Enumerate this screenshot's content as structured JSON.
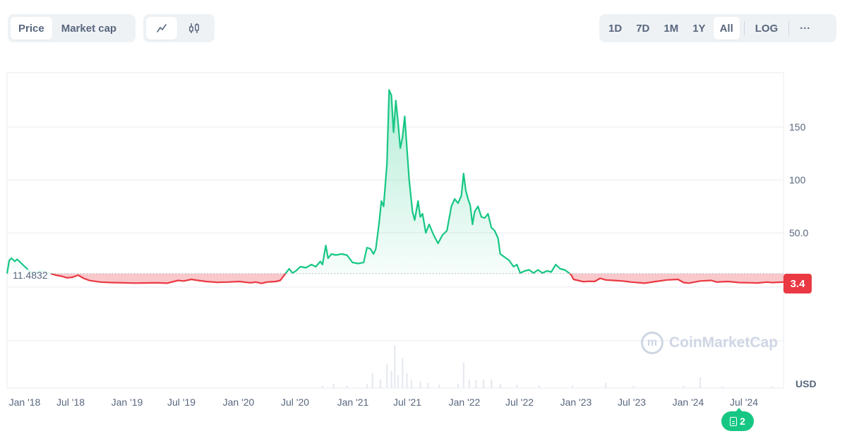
{
  "toolbar": {
    "type_tabs": [
      {
        "label": "Price",
        "active": true
      },
      {
        "label": "Market cap",
        "active": false
      }
    ],
    "view_tabs": [
      {
        "icon": "line-chart-icon",
        "active": true
      },
      {
        "icon": "candlestick-icon",
        "active": false
      }
    ],
    "range_tabs": [
      {
        "label": "1D",
        "active": false
      },
      {
        "label": "7D",
        "active": false
      },
      {
        "label": "1M",
        "active": false
      },
      {
        "label": "1Y",
        "active": false
      },
      {
        "label": "All",
        "active": true
      }
    ],
    "log_label": "LOG",
    "more_label": "···"
  },
  "chart": {
    "baseline_label": "11.4832",
    "current_price_label": "3.4",
    "currency_label": "USD",
    "watermark_text": "CoinMarketCap",
    "news_count": "2",
    "colors": {
      "up": "#16c784",
      "down": "#ea3943",
      "grid": "#f0f2f5",
      "volume": "#e6eaf0"
    }
  },
  "chart_data": {
    "type": "area",
    "title": "",
    "xlabel": "",
    "ylabel": "USD",
    "baseline": 11.4832,
    "current": 3.4,
    "y_ticks": [
      50,
      100,
      150
    ],
    "y_tick_labels": [
      "50.0",
      "100",
      "150"
    ],
    "ylim": [
      0,
      195
    ],
    "x_tick_labels": [
      "Jan '18",
      "Jul '18",
      "Jan '19",
      "Jul '19",
      "Jan '20",
      "Jul '20",
      "Jan '21",
      "Jul '21",
      "Jan '22",
      "Jul '22",
      "Jan '23",
      "Jul '23",
      "Jan '24",
      "Jul '24"
    ],
    "x_range": [
      2017.96,
      2024.95
    ],
    "series": [
      {
        "name": "Price",
        "points": [
          [
            2017.96,
            11.5
          ],
          [
            2017.98,
            24
          ],
          [
            2018.0,
            26
          ],
          [
            2018.03,
            23
          ],
          [
            2018.05,
            25
          ],
          [
            2018.08,
            22
          ],
          [
            2018.1,
            20
          ],
          [
            2018.13,
            17
          ],
          [
            2018.17,
            13
          ],
          [
            2018.21,
            12
          ],
          [
            2018.26,
            14
          ],
          [
            2018.31,
            13
          ],
          [
            2018.35,
            11.5
          ],
          [
            2018.4,
            10
          ],
          [
            2018.45,
            9
          ],
          [
            2018.5,
            7.5
          ],
          [
            2018.55,
            8
          ],
          [
            2018.6,
            10
          ],
          [
            2018.65,
            7
          ],
          [
            2018.7,
            5
          ],
          [
            2018.8,
            3.5
          ],
          [
            2018.9,
            3
          ],
          [
            2019.0,
            2.8
          ],
          [
            2019.1,
            2.5
          ],
          [
            2019.2,
            2.6
          ],
          [
            2019.3,
            2.8
          ],
          [
            2019.4,
            2.4
          ],
          [
            2019.5,
            5
          ],
          [
            2019.55,
            4.5
          ],
          [
            2019.62,
            6
          ],
          [
            2019.68,
            5
          ],
          [
            2019.75,
            4
          ],
          [
            2019.85,
            3.2
          ],
          [
            2019.95,
            3.5
          ],
          [
            2020.05,
            4
          ],
          [
            2020.15,
            2.8
          ],
          [
            2020.2,
            3.5
          ],
          [
            2020.25,
            2.2
          ],
          [
            2020.3,
            3.5
          ],
          [
            2020.38,
            4
          ],
          [
            2020.42,
            5
          ],
          [
            2020.47,
            12
          ],
          [
            2020.5,
            16
          ],
          [
            2020.53,
            12
          ],
          [
            2020.56,
            14
          ],
          [
            2020.6,
            18
          ],
          [
            2020.65,
            17
          ],
          [
            2020.7,
            20
          ],
          [
            2020.74,
            18
          ],
          [
            2020.78,
            23
          ],
          [
            2020.8,
            20
          ],
          [
            2020.83,
            38
          ],
          [
            2020.85,
            26
          ],
          [
            2020.88,
            30
          ],
          [
            2020.92,
            29
          ],
          [
            2020.97,
            30
          ],
          [
            2021.02,
            29
          ],
          [
            2021.07,
            22
          ],
          [
            2021.12,
            21
          ],
          [
            2021.17,
            22
          ],
          [
            2021.2,
            36
          ],
          [
            2021.23,
            35
          ],
          [
            2021.26,
            30
          ],
          [
            2021.28,
            35
          ],
          [
            2021.31,
            60
          ],
          [
            2021.33,
            80
          ],
          [
            2021.35,
            75
          ],
          [
            2021.38,
            115
          ],
          [
            2021.4,
            185
          ],
          [
            2021.42,
            180
          ],
          [
            2021.44,
            145
          ],
          [
            2021.46,
            175
          ],
          [
            2021.48,
            155
          ],
          [
            2021.5,
            130
          ],
          [
            2021.52,
            140
          ],
          [
            2021.54,
            160
          ],
          [
            2021.56,
            130
          ],
          [
            2021.58,
            100
          ],
          [
            2021.61,
            70
          ],
          [
            2021.63,
            62
          ],
          [
            2021.66,
            80
          ],
          [
            2021.68,
            65
          ],
          [
            2021.7,
            68
          ],
          [
            2021.73,
            50
          ],
          [
            2021.76,
            58
          ],
          [
            2021.8,
            48
          ],
          [
            2021.84,
            40
          ],
          [
            2021.88,
            48
          ],
          [
            2021.92,
            52
          ],
          [
            2021.96,
            75
          ],
          [
            2021.99,
            82
          ],
          [
            2022.02,
            78
          ],
          [
            2022.05,
            85
          ],
          [
            2022.07,
            106
          ],
          [
            2022.09,
            90
          ],
          [
            2022.11,
            82
          ],
          [
            2022.13,
            76
          ],
          [
            2022.15,
            58
          ],
          [
            2022.17,
            70
          ],
          [
            2022.2,
            75
          ],
          [
            2022.23,
            65
          ],
          [
            2022.26,
            64
          ],
          [
            2022.29,
            68
          ],
          [
            2022.32,
            55
          ],
          [
            2022.35,
            52
          ],
          [
            2022.38,
            45
          ],
          [
            2022.4,
            30
          ],
          [
            2022.44,
            27
          ],
          [
            2022.48,
            24
          ],
          [
            2022.52,
            18
          ],
          [
            2022.55,
            20
          ],
          [
            2022.58,
            12
          ],
          [
            2022.62,
            14
          ],
          [
            2022.66,
            15
          ],
          [
            2022.7,
            12
          ],
          [
            2022.74,
            15
          ],
          [
            2022.78,
            12
          ],
          [
            2022.82,
            14
          ],
          [
            2022.86,
            13
          ],
          [
            2022.9,
            20
          ],
          [
            2022.94,
            16
          ],
          [
            2022.98,
            15
          ],
          [
            2023.02,
            12
          ],
          [
            2023.04,
            10
          ],
          [
            2023.06,
            6
          ],
          [
            2023.1,
            5
          ],
          [
            2023.15,
            3.8
          ],
          [
            2023.2,
            4.2
          ],
          [
            2023.25,
            4
          ],
          [
            2023.3,
            7
          ],
          [
            2023.35,
            5.5
          ],
          [
            2023.42,
            5
          ],
          [
            2023.5,
            4.5
          ],
          [
            2023.58,
            3.5
          ],
          [
            2023.7,
            2.4
          ],
          [
            2023.8,
            4
          ],
          [
            2023.9,
            5.5
          ],
          [
            2024.0,
            6
          ],
          [
            2024.05,
            3
          ],
          [
            2024.1,
            2.5
          ],
          [
            2024.2,
            4.5
          ],
          [
            2024.3,
            5
          ],
          [
            2024.35,
            3.5
          ],
          [
            2024.45,
            4
          ],
          [
            2024.55,
            3
          ],
          [
            2024.65,
            2.8
          ],
          [
            2024.72,
            2.6
          ],
          [
            2024.8,
            3.5
          ],
          [
            2024.85,
            3
          ],
          [
            2024.9,
            3.3
          ],
          [
            2024.95,
            3.4
          ]
        ]
      },
      {
        "name": "Volume",
        "relative_bars": [
          [
            2020.8,
            0.05
          ],
          [
            2020.9,
            0.1
          ],
          [
            2021.02,
            0.05
          ],
          [
            2021.2,
            0.1
          ],
          [
            2021.25,
            0.35
          ],
          [
            2021.32,
            0.2
          ],
          [
            2021.38,
            0.55
          ],
          [
            2021.42,
            0.4
          ],
          [
            2021.45,
            1.0
          ],
          [
            2021.48,
            0.3
          ],
          [
            2021.52,
            0.7
          ],
          [
            2021.56,
            0.35
          ],
          [
            2021.6,
            0.2
          ],
          [
            2021.68,
            0.15
          ],
          [
            2021.75,
            0.12
          ],
          [
            2021.85,
            0.08
          ],
          [
            2022.02,
            0.1
          ],
          [
            2022.07,
            0.6
          ],
          [
            2022.12,
            0.2
          ],
          [
            2022.18,
            0.18
          ],
          [
            2022.25,
            0.2
          ],
          [
            2022.32,
            0.2
          ],
          [
            2022.4,
            0.1
          ],
          [
            2022.55,
            0.08
          ],
          [
            2022.75,
            0.06
          ],
          [
            2023.05,
            0.06
          ],
          [
            2023.35,
            0.12
          ],
          [
            2023.6,
            0.05
          ],
          [
            2024.05,
            0.05
          ],
          [
            2024.2,
            0.25
          ],
          [
            2024.4,
            0.04
          ],
          [
            2024.85,
            0.04
          ]
        ]
      }
    ],
    "grid": true,
    "legend": "none"
  }
}
